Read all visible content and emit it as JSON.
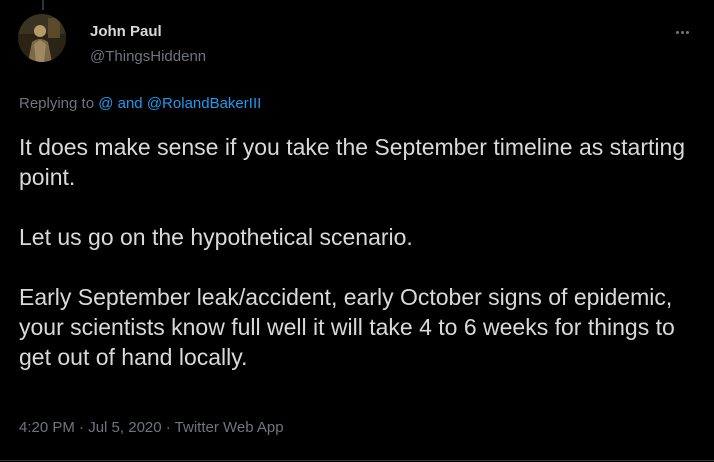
{
  "author": {
    "name": "John Paul",
    "handle": "@ThingsHiddenn"
  },
  "more_icon": "more-horizontal-icon",
  "reply_context": {
    "prefix": "Replying to ",
    "mention_1": "@",
    "connector": " and ",
    "mention_2": "@RolandBakerIII"
  },
  "tweet": {
    "paragraphs": [
      "It does make sense if you take the September timeline as starting point.",
      "Let us go on the hypothetical scenario.",
      "Early September leak/accident, early October signs of epidemic, your scientists know full well it will take 4 to 6 weeks for things to get out of hand locally."
    ]
  },
  "meta": {
    "time": "4:20 PM",
    "sep_1": " · ",
    "date": "Jul 5, 2020",
    "sep_2": " · ",
    "source": "Twitter Web App"
  },
  "colors": {
    "background": "#000000",
    "text": "#d9d9d9",
    "muted": "#6e767d",
    "link": "#1d9bf0"
  }
}
